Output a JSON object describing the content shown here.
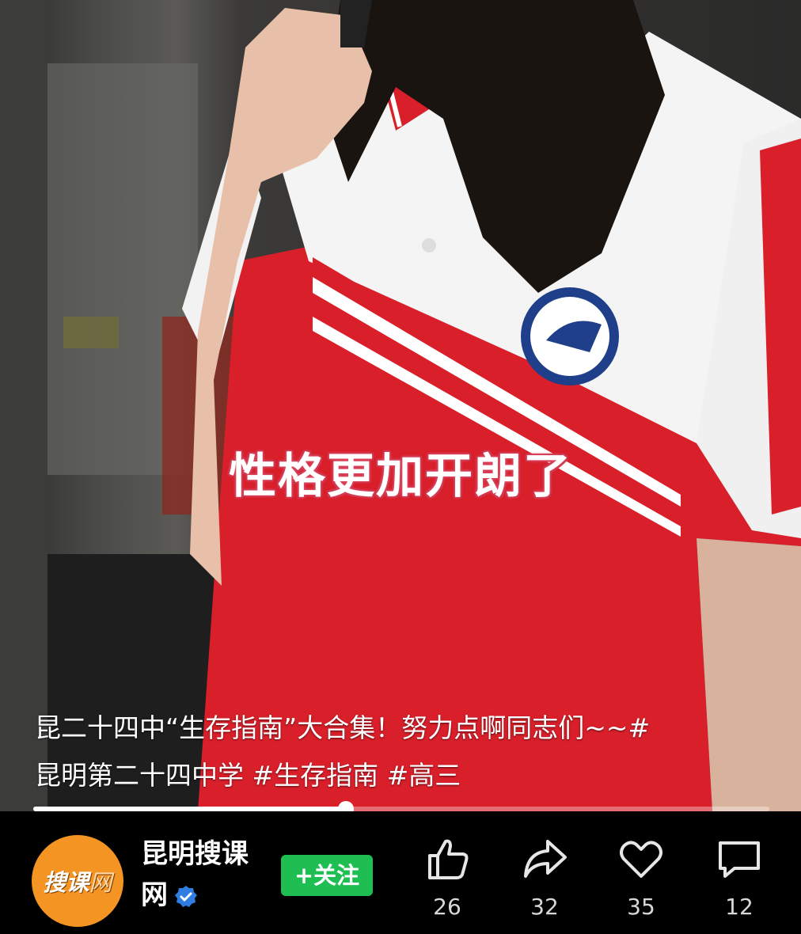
{
  "video": {
    "overlay_text": "性格更加开朗了",
    "caption_line1": "昆二十四中“生存指南”大合集！努力点啊同志们~~#",
    "caption_line2": "昆明第二十四中学 #生存指南 #高三",
    "progress_fraction": 0.425
  },
  "author": {
    "avatar_text_main": "搜课",
    "avatar_text_sub": "网",
    "name": "昆明搜课网",
    "verified": true
  },
  "follow_button": "+关注",
  "actions": [
    {
      "icon": "thumbs-up-icon",
      "count": "26"
    },
    {
      "icon": "share-icon",
      "count": "32"
    },
    {
      "icon": "heart-icon",
      "count": "35"
    },
    {
      "icon": "comment-icon",
      "count": "12"
    }
  ],
  "colors": {
    "uniform_red": "#d81f2a",
    "follow_green": "#1ebe52",
    "avatar_orange": "#f39423",
    "verified_blue": "#2f7de1"
  }
}
